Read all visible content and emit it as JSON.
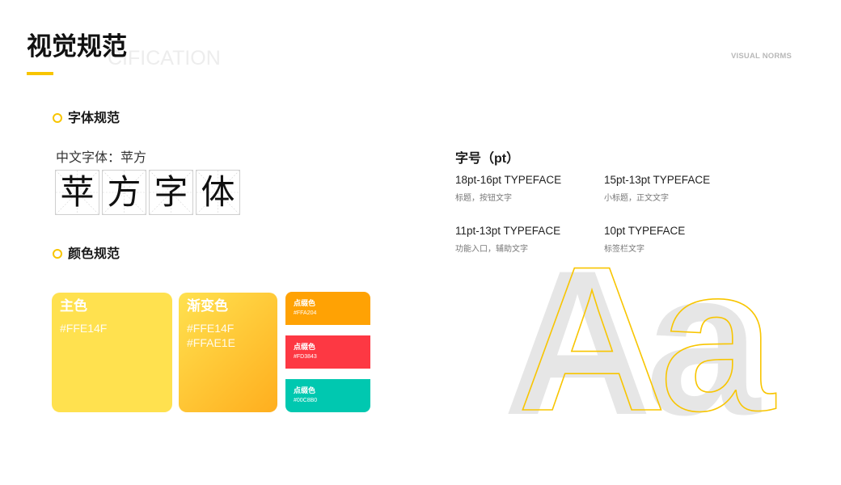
{
  "theme": {
    "accent": "#F8C500"
  },
  "header": {
    "title": "视觉规范",
    "watermark": "CIFICATION",
    "top_right_label": "VISUAL NORMS"
  },
  "font_spec": {
    "heading": "字体规范",
    "chinese_font": "中文字体：苹方",
    "sample_chars": [
      "苹",
      "方",
      "字",
      "体"
    ]
  },
  "color_spec": {
    "heading": "颜色规范",
    "primary": {
      "label": "主色",
      "hex": "#FFE14F"
    },
    "gradient": {
      "label": "渐变色",
      "hex_start": "#FFE14F",
      "hex_end": "#FFAE1E"
    },
    "accents": [
      {
        "label": "点缀色",
        "hex": "#FFA204"
      },
      {
        "label": "点缀色",
        "hex": "#FD3843"
      },
      {
        "label": "点缀色",
        "hex": "#00C8B0"
      }
    ]
  },
  "size_spec": {
    "heading": "字号（pt）",
    "items": [
      {
        "size": "18pt-16pt TYPEFACE",
        "usage": "标题，按钮文字"
      },
      {
        "size": "15pt-13pt TYPEFACE",
        "usage": "小标题，正文文字"
      },
      {
        "size": "11pt-13pt TYPEFACE",
        "usage": "功能入口，辅助文字"
      },
      {
        "size": "10pt TYPEFACE",
        "usage": "标签栏文字"
      }
    ]
  },
  "decor": {
    "glyphs": "Aa",
    "fill_color": "#E6E6E6"
  }
}
